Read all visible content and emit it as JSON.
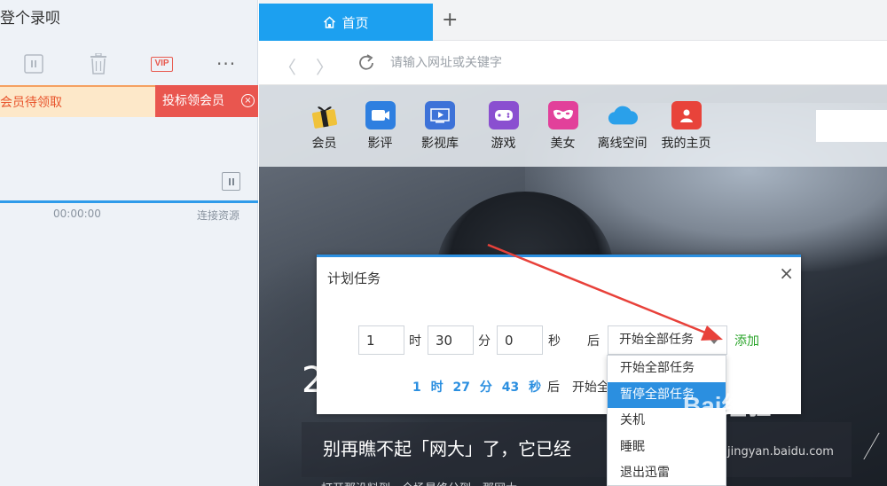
{
  "left_panel": {
    "title": "登个录呗",
    "toolbar": {
      "vip_label": "VIP",
      "more_label": "···"
    },
    "promo": {
      "left_text": "会员待领取",
      "right_text": "投标领会员",
      "close_label": "×"
    },
    "task": {
      "time": "00:00:00",
      "status": "连接资源",
      "progress": 1.0
    }
  },
  "browser": {
    "tab": {
      "label": "首页"
    },
    "new_tab_label": "+",
    "address": {
      "placeholder": "请输入网址或关键字",
      "back_label": "〈",
      "forward_label": "〉"
    },
    "apps": [
      {
        "label": "会员",
        "icon": "gift-icon",
        "color": "#f0c23a"
      },
      {
        "label": "影评",
        "icon": "film-icon",
        "color": "#2e7fe0"
      },
      {
        "label": "影视库",
        "icon": "play-icon",
        "color": "#3d72d8"
      },
      {
        "label": "游戏",
        "icon": "game-icon",
        "color": "#8a4fd0"
      },
      {
        "label": "美女",
        "icon": "mask-icon",
        "color": "#e2409a"
      },
      {
        "label": "离线空间",
        "icon": "cloud-icon",
        "color": "#2aa0ea"
      },
      {
        "label": "我的主页",
        "icon": "profile-icon",
        "color": "#e8433a"
      }
    ],
    "hero": {
      "digit": "2",
      "caption": "别再瞧不起「网大」了，它已经",
      "caption_sub": "打开那没料到，全场最终分到，那网大"
    }
  },
  "dialog": {
    "title": "计划任务",
    "close_label": "×",
    "hours_value": "1",
    "hours_unit": "时",
    "minutes_value": "30",
    "minutes_unit": "分",
    "seconds_value": "0",
    "seconds_unit": "秒",
    "after_label": "后",
    "selected_action": "开始全部任务",
    "add_label": "添加",
    "countdown": "1 时 27 分 43 秒",
    "countdown_after": "后",
    "countdown_action": "开始全部任务",
    "options": [
      "开始全部任务",
      "暂停全部任务",
      "关机",
      "睡眠",
      "退出迅雷"
    ],
    "highlighted_option": "暂停全部任务"
  },
  "watermark": {
    "text": "Bai经验",
    "sub": "jingyan.baidu.com"
  },
  "colors": {
    "accent": "#2b8fe0",
    "tab": "#1ca0f0",
    "add_green": "#2aa42a",
    "annotation_arrow": "#e8413a"
  }
}
